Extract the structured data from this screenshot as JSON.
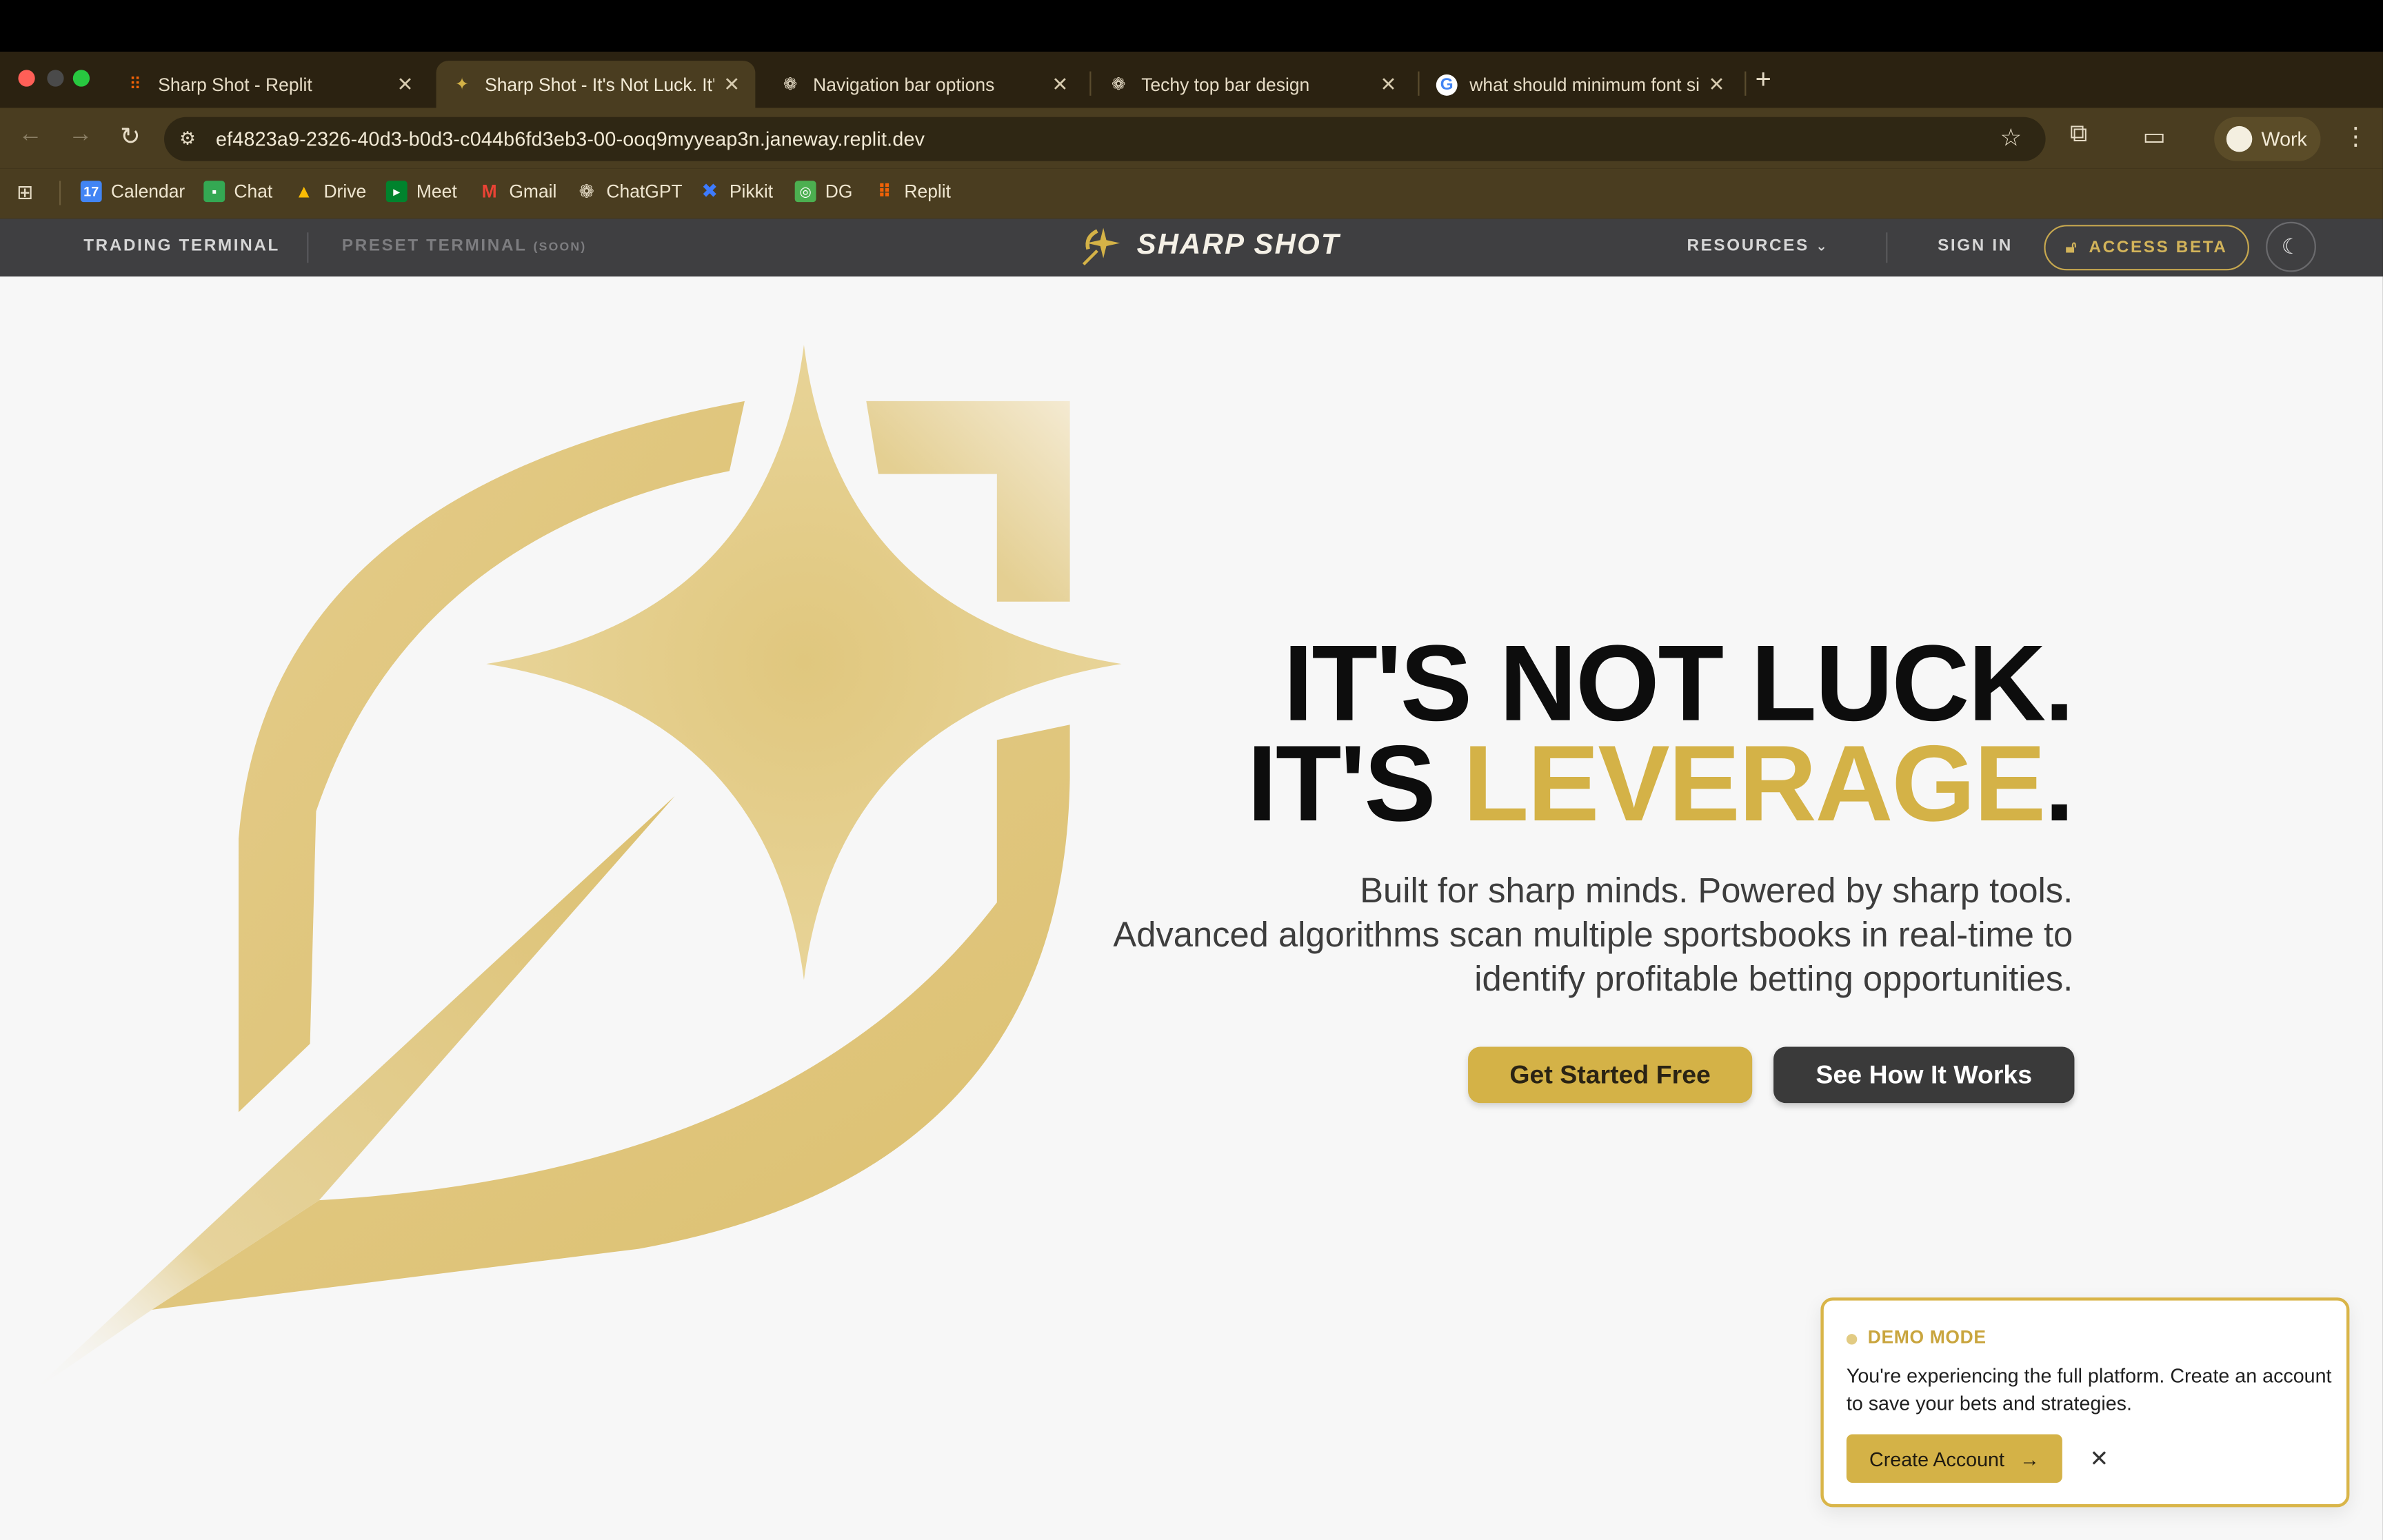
{
  "browser": {
    "tabs": [
      {
        "title": "Sharp Shot - Replit",
        "icon": "replit-icon"
      },
      {
        "title": "Sharp Shot - It's Not Luck. It's Leverage",
        "icon": "sharpshot-icon",
        "active": true
      },
      {
        "title": "Navigation bar options",
        "icon": "chatgpt-icon"
      },
      {
        "title": "Techy top bar design",
        "icon": "chatgpt-icon"
      },
      {
        "title": "what should minimum font size",
        "icon": "google-icon"
      }
    ],
    "url": "ef4823a9-2326-40d3-b0d3-c044b6fd3eb3-00-ooq9myyeap3n.janeway.replit.dev",
    "profile_label": "Work",
    "bookmarks": [
      "Calendar",
      "Chat",
      "Drive",
      "Meet",
      "Gmail",
      "ChatGPT",
      "Pikkit",
      "DG",
      "Replit"
    ]
  },
  "site_nav": {
    "trading_terminal": "TRADING TERMINAL",
    "preset_terminal": "PRESET TERMINAL",
    "soon": "(SOON)",
    "brand": "SHARP SHOT",
    "resources": "RESOURCES",
    "sign_in": "SIGN IN",
    "access_beta": "ACCESS BETA"
  },
  "hero": {
    "line1": "IT'S NOT LUCK.",
    "line2_prefix": "IT'S ",
    "line2_highlight": "LEVERAGE",
    "line2_suffix": ".",
    "sub1": "Built for sharp minds. Powered by sharp tools.",
    "sub2": "Advanced algorithms scan multiple sportsbooks in real-time to identify profitable betting opportunities.",
    "cta_primary": "Get Started Free",
    "cta_secondary": "See How It Works"
  },
  "demo": {
    "title": "DEMO MODE",
    "body": "You're experiencing the full platform. Create an account to save your bets and strategies.",
    "button": "Create Account"
  },
  "colors": {
    "accent_gold": "#d4b247",
    "chrome_brown": "#4a3d20",
    "nav_gray": "#3f3f41"
  }
}
